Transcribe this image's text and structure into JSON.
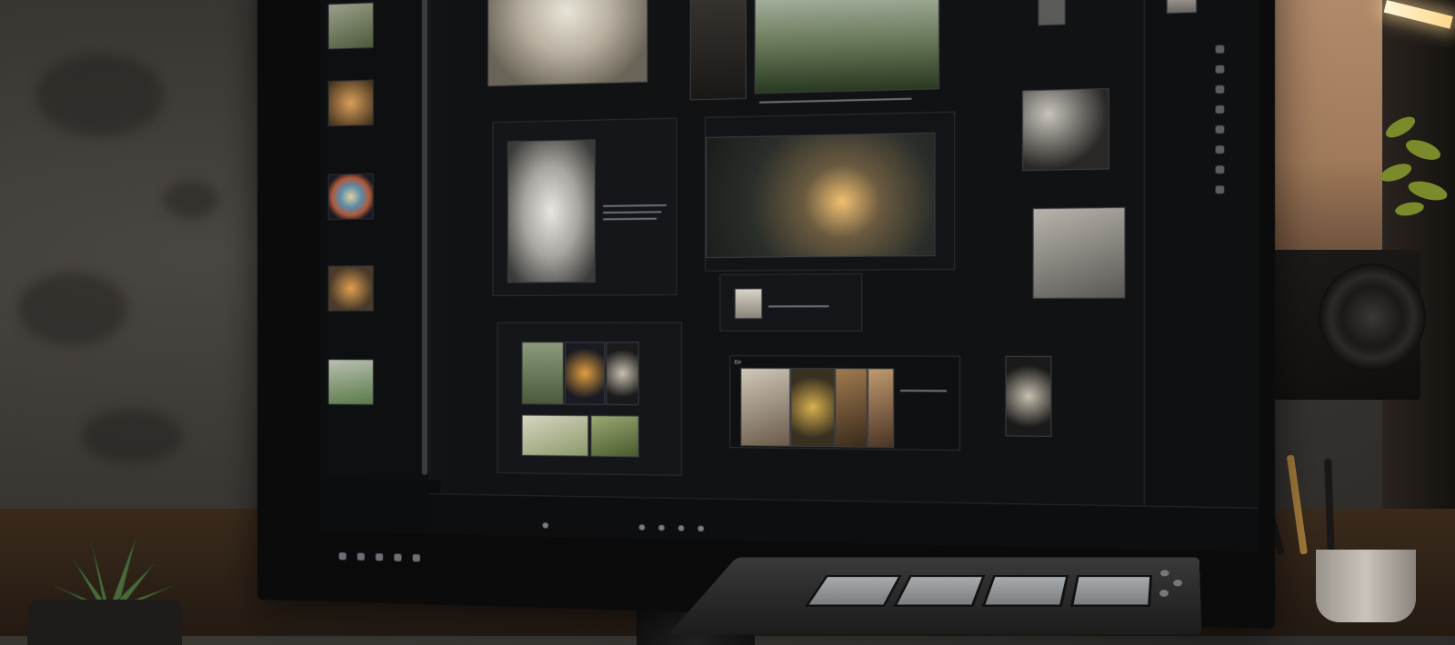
{
  "scene": {
    "description_colors": {
      "wall": "#3a3733",
      "screen_bg": "#121316",
      "accent_warm": "#ffd88a"
    }
  },
  "left_panel": {
    "items": [
      {
        "label": ""
      },
      {
        "label": ""
      },
      {
        "label": ""
      },
      {
        "label": ""
      },
      {
        "label": ""
      },
      {
        "label": ""
      }
    ]
  },
  "cards": {
    "card_single": {
      "title": "",
      "body": ""
    },
    "card_small": {
      "title": "",
      "body": ""
    },
    "card_grid": {
      "title": ""
    },
    "card_strip": {
      "title": "Dr",
      "caption": ""
    }
  },
  "toolbar": {
    "items": [
      "",
      "",
      "",
      "",
      "",
      "",
      "",
      "",
      "",
      "",
      "",
      "",
      "",
      "",
      ""
    ]
  }
}
